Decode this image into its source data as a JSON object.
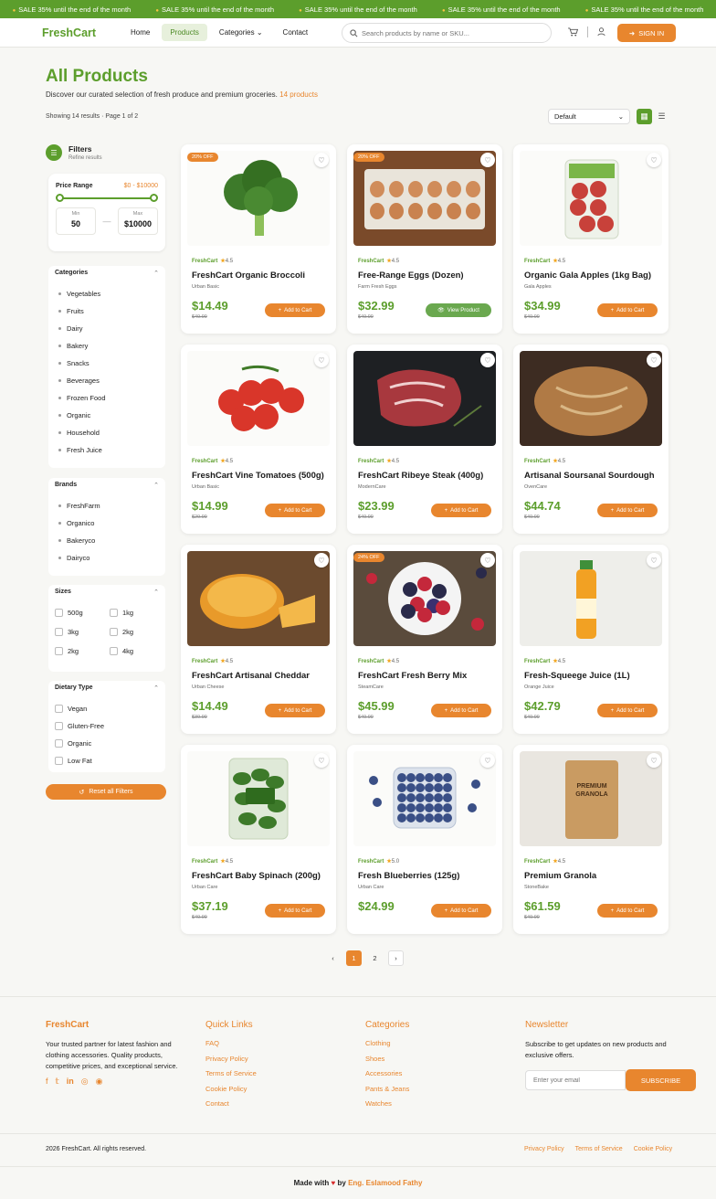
{
  "promo": {
    "messages": [
      "SALE 35% until the end of the month",
      "SALE 35% until the end of the month",
      "SALE 35% until the end of the month",
      "SALE 35% until the end of the month",
      "SALE 35% until the end of the month"
    ]
  },
  "header": {
    "logo": "FreshCart",
    "nav": [
      "Home",
      "Products",
      "Categories",
      "Contact"
    ],
    "active_nav": "Products",
    "search_placeholder": "Search products by name or SKU...",
    "signin_label": "SIGN IN"
  },
  "page": {
    "title": "All Products",
    "subtitle": "Discover our curated selection of fresh produce and premium groceries.",
    "count_label": "14 products",
    "showing": "Showing 14 results · Page 1 of 2",
    "sort_value": "Default"
  },
  "filters": {
    "title": "Filters",
    "subtitle": "Refine results",
    "price": {
      "label": "Price Range",
      "range": "$0 - $10000",
      "min_label": "Min",
      "min_value": "50",
      "max_label": "Max",
      "max_value": "$10000",
      "separator": "—"
    },
    "categories": {
      "title": "Categories",
      "items": [
        "Vegetables",
        "Fruits",
        "Dairy",
        "Bakery",
        "Snacks",
        "Beverages",
        "Frozen Food",
        "Organic",
        "Household",
        "Fresh Juice"
      ]
    },
    "brands": {
      "title": "Brands",
      "items": [
        "FreshFarm",
        "Organico",
        "Bakeryco",
        "Dairyco"
      ]
    },
    "sizes": {
      "title": "Sizes",
      "items": [
        "500g",
        "1kg",
        "3kg",
        "2kg",
        "2kg",
        "4kg"
      ]
    },
    "dietary": {
      "title": "Dietary Type",
      "items": [
        "Vegan",
        "Gluten-Free",
        "Organic",
        "Low Fat"
      ]
    },
    "reset_label": "Reset all Filters"
  },
  "products": [
    {
      "brand": "FreshCart",
      "rating": "4.5",
      "name": "FreshCart Organic Broccoli",
      "sub": "Urban Basic",
      "price": "$14.49",
      "old": "$49.99",
      "badge": "20% OFF",
      "cart": "Add to Cart",
      "img": "broccoli"
    },
    {
      "brand": "FreshCart",
      "rating": "4.5",
      "name": "Free-Range Eggs (Dozen)",
      "sub": "Farm Fresh Eggs",
      "price": "$32.99",
      "old": "$49.99",
      "badge": "20% OFF",
      "cart": "View Product",
      "img": "eggs"
    },
    {
      "brand": "FreshCart",
      "rating": "4.5",
      "name": "Organic Gala Apples (1kg Bag)",
      "sub": "Gala Apples",
      "price": "$34.99",
      "old": "$49.99",
      "badge": "",
      "cart": "Add to Cart",
      "img": "apples"
    },
    {
      "brand": "FreshCart",
      "rating": "4.5",
      "name": "FreshCart Vine Tomatoes (500g)",
      "sub": "Urban Basic",
      "price": "$14.99",
      "old": "$29.99",
      "badge": "",
      "cart": "Add to Cart",
      "img": "tomatoes"
    },
    {
      "brand": "FreshCart",
      "rating": "4.5",
      "name": "FreshCart Ribeye Steak (400g)",
      "sub": "ModernCare",
      "price": "$23.99",
      "old": "$49.99",
      "badge": "",
      "cart": "Add to Cart",
      "img": "steak"
    },
    {
      "brand": "FreshCart",
      "rating": "4.5",
      "name": "Artisanal Soursanal Sourdough",
      "sub": "OvenCare",
      "price": "$44.74",
      "old": "$49.99",
      "badge": "",
      "cart": "Add to Cart",
      "img": "bread"
    },
    {
      "brand": "FreshCart",
      "rating": "4.5",
      "name": "FreshCart Artisanal Cheddar",
      "sub": "Urban Cheese",
      "price": "$14.49",
      "old": "$39.99",
      "badge": "",
      "cart": "Add to Cart",
      "img": "cheese"
    },
    {
      "brand": "FreshCart",
      "rating": "4.5",
      "name": "FreshCart Fresh Berry Mix",
      "sub": "SteamCare",
      "price": "$45.99",
      "old": "$49.99",
      "badge": "24% OFF",
      "cart": "Add to Cart",
      "img": "berries"
    },
    {
      "brand": "FreshCart",
      "rating": "4.5",
      "name": "Fresh-Squeege Juice (1L)",
      "sub": "Orange Juice",
      "price": "$42.79",
      "old": "$49.99",
      "badge": "",
      "cart": "Add to Cart",
      "img": "juice"
    },
    {
      "brand": "FreshCart",
      "rating": "4.5",
      "name": "FreshCart Baby Spinach (200g)",
      "sub": "Urban Care",
      "price": "$37.19",
      "old": "$49.99",
      "badge": "",
      "cart": "Add to Cart",
      "img": "spinach"
    },
    {
      "brand": "FreshCart",
      "rating": "5.0",
      "name": "Fresh Blueberries (125g)",
      "sub": "Urban Care",
      "price": "$24.99",
      "old": "",
      "badge": "",
      "cart": "Add to Cart",
      "img": "blueberries"
    },
    {
      "brand": "FreshCart",
      "rating": "4.5",
      "name": "Premium Granola",
      "sub": "StoneBake",
      "price": "$61.59",
      "old": "$49.99",
      "badge": "",
      "cart": "Add to Cart",
      "img": "granola"
    }
  ],
  "granola_pack": {
    "line1": "PREMIUM",
    "line2": "GRANOLA"
  },
  "pagination": {
    "prev": "‹",
    "pages": [
      "1",
      "2"
    ],
    "current": "1",
    "next": "›"
  },
  "footer": {
    "brand": "FreshCart",
    "about": "Your trusted partner for latest fashion and clothing accessories. Quality products, competitive prices, and exceptional service.",
    "quick_title": "Quick Links",
    "quick_links": [
      "FAQ",
      "Privacy Policy",
      "Terms of Service",
      "Cookie Policy",
      "Contact"
    ],
    "cat_title": "Categories",
    "cat_links": [
      "Clothing",
      "Shoes",
      "Accessories",
      "Pants & Jeans",
      "Watches"
    ],
    "news_title": "Newsletter",
    "news_text": "Subscribe to get updates on new products and exclusive offers.",
    "email_placeholder": "Enter your email",
    "subscribe_label": "SUBSCRIBE",
    "copyright": "2026 FreshCart. All rights reserved.",
    "bottom_links": [
      "Privacy Policy",
      "Terms of Service",
      "Cookie Policy"
    ],
    "made_prefix": "Made with",
    "made_by": "by",
    "author": "Eng. Eslamood Fathy"
  },
  "colors": {
    "brand_green": "#5c9e2c",
    "accent_orange": "#e8862e"
  }
}
